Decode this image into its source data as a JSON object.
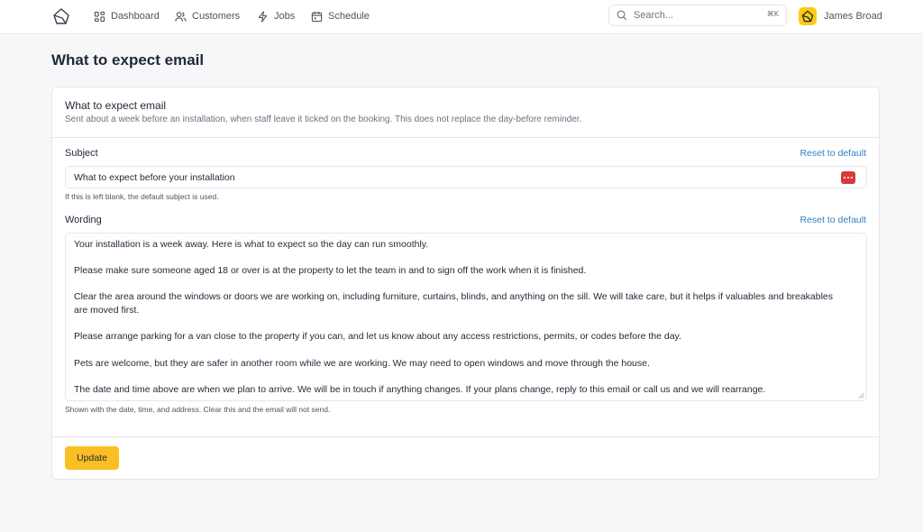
{
  "nav": {
    "items": [
      {
        "label": "Dashboard",
        "icon": "dashboard-icon"
      },
      {
        "label": "Customers",
        "icon": "users-icon"
      },
      {
        "label": "Jobs",
        "icon": "lightning-icon"
      },
      {
        "label": "Schedule",
        "icon": "calendar-icon"
      }
    ],
    "search_placeholder": "Search...",
    "search_shortcut": "⌘K",
    "user_name": "James Broad"
  },
  "page": {
    "title": "What to expect email"
  },
  "card": {
    "title": "What to expect email",
    "subtitle": "Sent about a week before an installation, when staff leave it ticked on the booking. This does not replace the day-before reminder.",
    "subject": {
      "label": "Subject",
      "reset_label": "Reset to default",
      "value": "What to expect before your installation",
      "hint": "If this is left blank, the default subject is used."
    },
    "wording": {
      "label": "Wording",
      "reset_label": "Reset to default",
      "paragraphs": [
        "Your installation is a week away. Here is what to expect so the day can run smoothly.",
        "Please make sure someone aged 18 or over is at the property to let the team in and to sign off the work when it is finished.",
        "Clear the area around the windows or doors we are working on, including furniture, curtains, blinds, and anything on the sill. We will take care, but it helps if valuables and breakables are moved first.",
        "Please arrange parking for a van close to the property if you can, and let us know about any access restrictions, permits, or codes before the day.",
        "Pets are welcome, but they are safer in another room while we are working. We may need to open windows and move through the house.",
        "The date and time above are when we plan to arrive. We will be in touch if anything changes. If your plans change, reply to this email or call us and we will rearrange."
      ],
      "hint": "Shown with the date, time, and address. Clear this and the email will not send."
    },
    "update_label": "Update"
  },
  "colors": {
    "accent": "#fbbf24",
    "link": "#2f7fc1",
    "password_icon": "#d93b3b"
  }
}
